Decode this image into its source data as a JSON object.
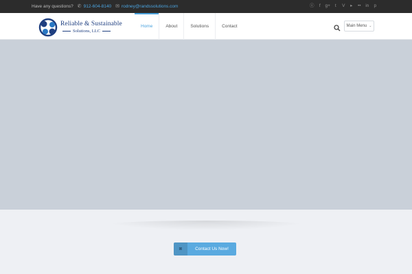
{
  "topbar": {
    "question": "Have any questions?",
    "phone": "912-604-8140",
    "email": "rodney@randssolutions.com",
    "social_icons": [
      "skype-icon",
      "facebook-icon",
      "google-plus-icon",
      "twitter-icon",
      "vimeo-icon",
      "youtube-icon",
      "flickr-icon",
      "linkedin-icon",
      "pinterest-icon"
    ]
  },
  "logo": {
    "line1": "Reliable & Sustainable",
    "line2": "Solutions, LLC"
  },
  "nav": {
    "items": [
      {
        "label": "Home",
        "active": true
      },
      {
        "label": "About"
      },
      {
        "label": "Solutions"
      },
      {
        "label": "Contact"
      }
    ],
    "menu_button": "Main Menu"
  },
  "cta": {
    "label": "Contact Us Now!"
  },
  "colors": {
    "accent": "#4ba3de",
    "topbar_bg": "#2c2c2c",
    "hero_bg": "#c9d0d9",
    "brand": "#1f3f80"
  }
}
